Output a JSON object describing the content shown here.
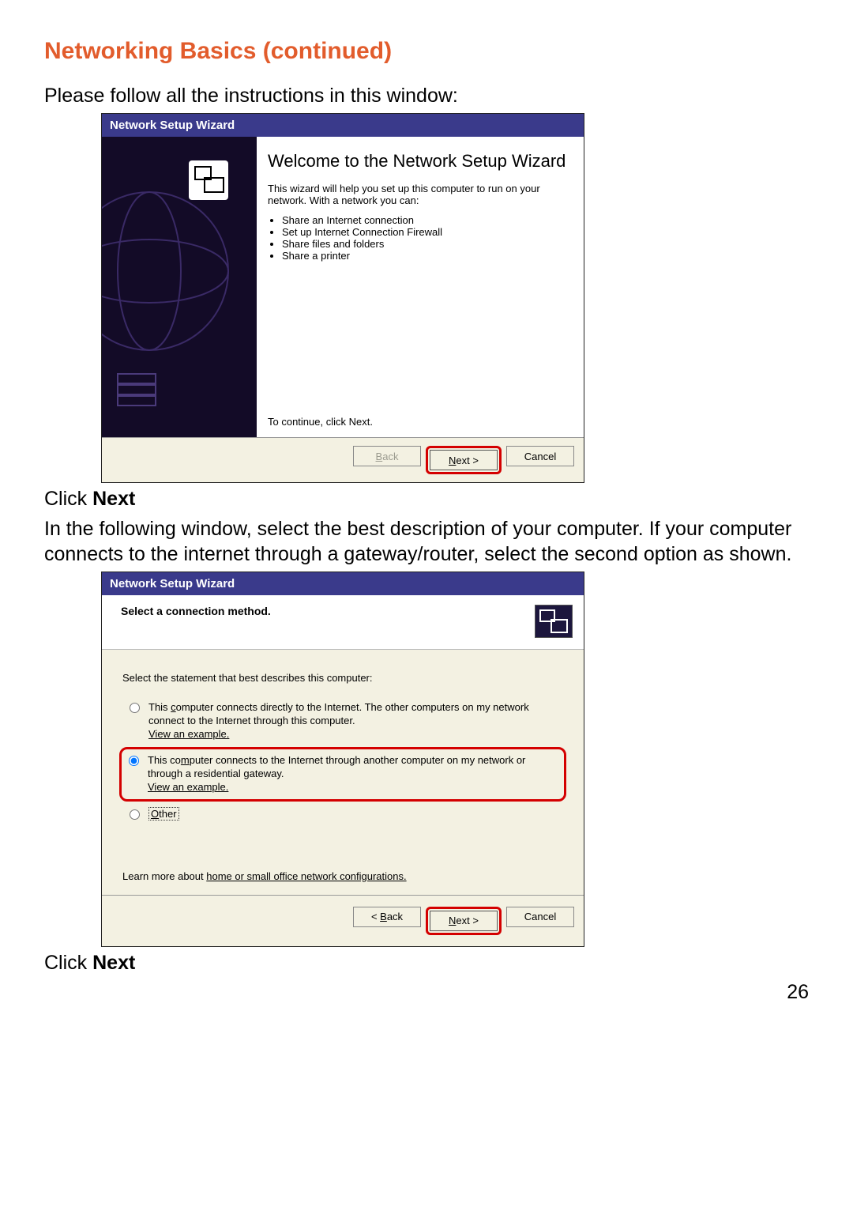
{
  "page": {
    "section_title": "Networking Basics (continued)",
    "intro": "Please follow all the instructions in this window:",
    "click_prefix": "Click ",
    "click_target": "Next",
    "second_para": "In the following window, select the best description of your computer. If your computer connects to the internet through a gateway/router, select the second option as shown.",
    "page_number": "26"
  },
  "wizard1": {
    "title": "Network Setup Wizard",
    "heading": "Welcome to the Network Setup Wizard",
    "desc": "This wizard will help you set up this computer to run on your network. With a network you can:",
    "bullets": [
      "Share an Internet connection",
      "Set up Internet Connection Firewall",
      "Share files and folders",
      "Share a printer"
    ],
    "continue": "To continue, click Next.",
    "buttons": {
      "back": "< Back",
      "next": "Next >",
      "cancel": "Cancel"
    }
  },
  "wizard2": {
    "title": "Network Setup Wizard",
    "header": "Select a connection method.",
    "prompt": "Select the statement that best describes this computer:",
    "opt1": "This computer connects directly to the Internet. The other computers on my network connect to the Internet through this computer.",
    "opt2": "This computer connects to the Internet through another computer on my network or through a residential gateway.",
    "view_example": "View an example.",
    "opt3": "Other",
    "learn_prefix": "Learn more about ",
    "learn_link": "home or small office network configurations.",
    "buttons": {
      "back": "< Back",
      "next": "Next >",
      "cancel": "Cancel"
    }
  }
}
